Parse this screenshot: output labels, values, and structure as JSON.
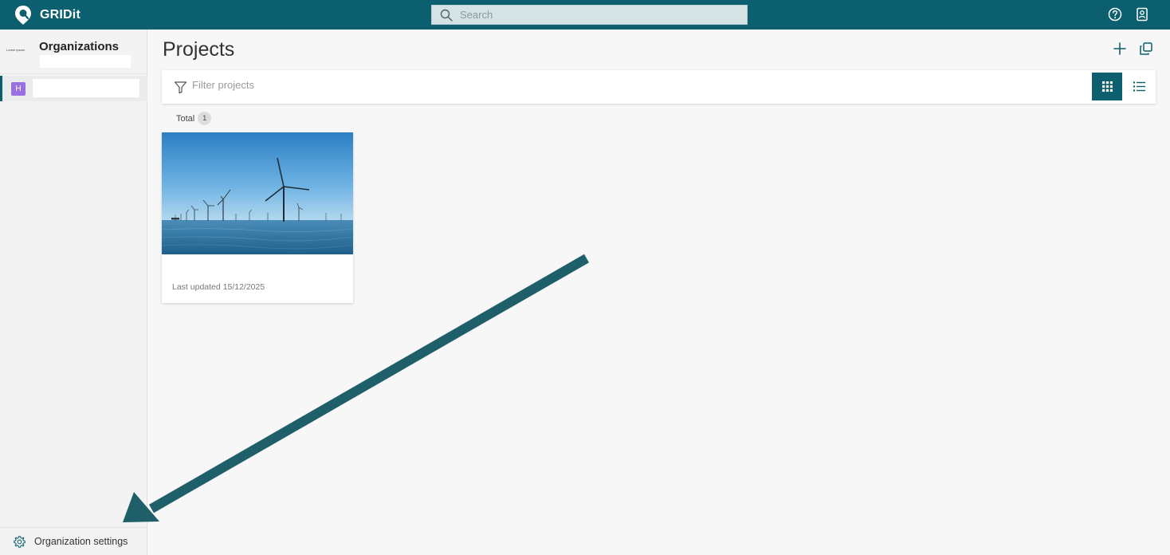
{
  "app": {
    "name": "GRIDit",
    "accent": "#0c5f6e"
  },
  "search": {
    "placeholder": "Search"
  },
  "topbar": {
    "icons": [
      "help-icon",
      "contact-card-icon"
    ]
  },
  "sidebar": {
    "title": "Organizations",
    "org_logo_text": "Lorem ipsum",
    "items": [
      {
        "avatar": "H",
        "name": ""
      }
    ],
    "settings_label": "Organization settings"
  },
  "main": {
    "title": "Projects",
    "actions": [
      "add-icon",
      "copy-icon"
    ],
    "filter": {
      "placeholder": "Filter projects"
    },
    "total_label": "Total",
    "total_count": "1",
    "view_modes": [
      "grid",
      "list"
    ],
    "active_view": "grid",
    "projects": [
      {
        "image": "offshore wind turbines",
        "updated": "Last updated 15/12/2025"
      }
    ]
  },
  "annotation": {
    "type": "arrow",
    "color": "#1e5f6a",
    "points_to": "Organization settings"
  }
}
